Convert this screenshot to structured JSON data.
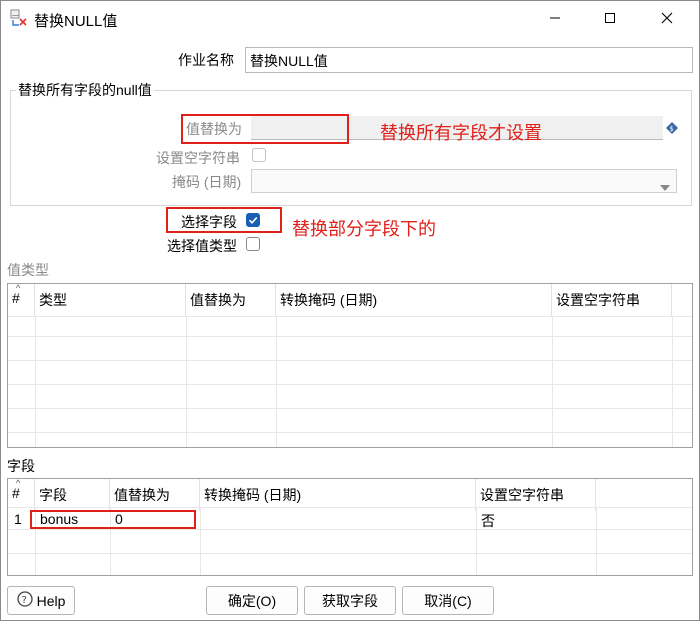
{
  "window": {
    "title": "替换NULL值",
    "minimize_icon": "minimize-icon",
    "maximize_icon": "maximize-icon",
    "close_icon": "close-icon"
  },
  "job": {
    "label": "作业名称",
    "value": "替换NULL值"
  },
  "all_fields_group": {
    "title": "替换所有字段的null值",
    "replace_with_label": "值替换为",
    "replace_with_value": "",
    "set_empty_label": "设置空字符串",
    "set_empty_checked": false,
    "mask_label": "掩码 (日期)",
    "mask_value": "",
    "annotation": "替换所有字段才设置"
  },
  "select_fields": {
    "label": "选择字段",
    "checked": true,
    "annotation": "替换部分字段下的"
  },
  "select_value_type": {
    "label": "选择值类型",
    "checked": false
  },
  "value_type_section": {
    "title": "值类型",
    "columns": [
      "#",
      "类型",
      "值替换为",
      "转换掩码 (日期)",
      "设置空字符串"
    ],
    "rows": []
  },
  "fields_section": {
    "title": "字段",
    "columns": [
      "#",
      "字段",
      "值替换为",
      "转换掩码 (日期)",
      "设置空字符串"
    ],
    "rows": [
      {
        "num": "1",
        "field": "bonus",
        "replace": "0",
        "mask": "",
        "set_empty": "否"
      }
    ]
  },
  "buttons": {
    "help": "Help",
    "ok": "确定(O)",
    "get_fields": "获取字段",
    "cancel": "取消(C)"
  },
  "colors": {
    "annotation_red": "#e0201b",
    "checkbox_blue": "#1a5fb4"
  }
}
